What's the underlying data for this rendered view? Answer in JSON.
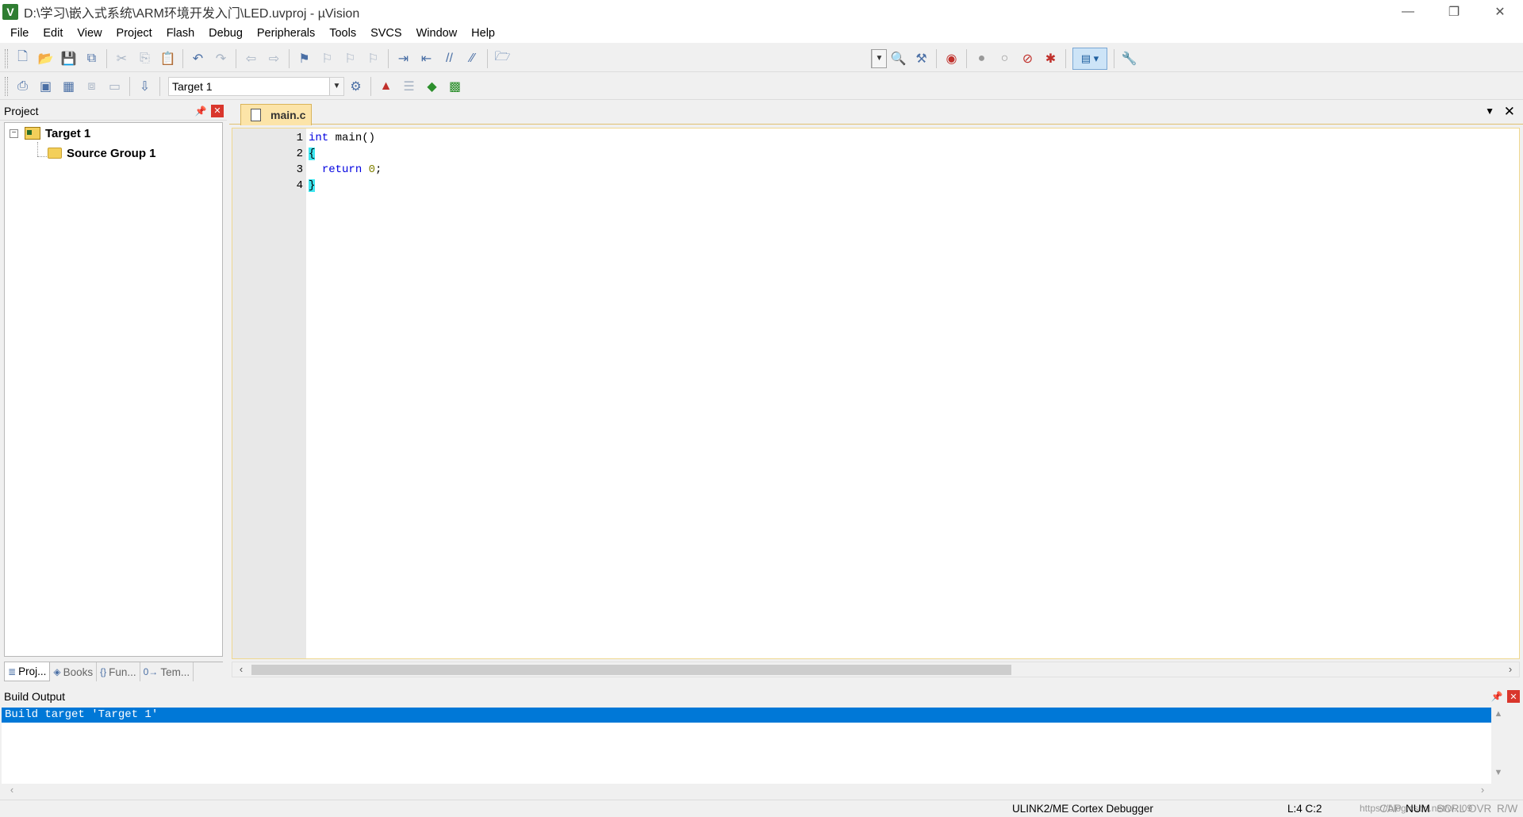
{
  "window": {
    "title": "D:\\学习\\嵌入式系统\\ARM环境开发入门\\LED.uvproj - µVision",
    "app_icon_letter": "V",
    "minimize": "—",
    "restore": "❐",
    "close": "✕"
  },
  "menu": [
    "File",
    "Edit",
    "View",
    "Project",
    "Flash",
    "Debug",
    "Peripherals",
    "Tools",
    "SVCS",
    "Window",
    "Help"
  ],
  "toolbar2": {
    "target_select": "Target 1"
  },
  "project_panel": {
    "title": "Project",
    "tree": {
      "root_label": "Target 1",
      "expander": "−",
      "child_label": "Source Group 1"
    },
    "tabs": [
      "Proj...",
      "Books",
      "Fun...",
      "Tem..."
    ],
    "tab_icons": [
      "≣",
      "◈",
      "{}",
      "0→"
    ]
  },
  "editor": {
    "tab_label": "main.c",
    "lines": [
      {
        "no": "1",
        "tokens": [
          {
            "t": "int",
            "c": "kw"
          },
          {
            "t": " main()",
            "c": ""
          }
        ]
      },
      {
        "no": "2",
        "tokens": [
          {
            "t": "{",
            "c": "brace"
          }
        ]
      },
      {
        "no": "3",
        "tokens": [
          {
            "t": "  ",
            "c": ""
          },
          {
            "t": "return",
            "c": "kw"
          },
          {
            "t": " ",
            "c": ""
          },
          {
            "t": "0",
            "c": "num"
          },
          {
            "t": ";",
            "c": ""
          }
        ]
      },
      {
        "no": "4",
        "tokens": [
          {
            "t": "}",
            "c": "brace"
          }
        ]
      }
    ]
  },
  "build_output": {
    "title": "Build Output",
    "line": "Build target 'Target 1'"
  },
  "statusbar": {
    "debugger": "ULINK2/ME Cortex Debugger",
    "position": "L:4 C:2",
    "cap": "CAP",
    "num": "NUM",
    "scrl": "SCRL",
    "ovr": "OVR",
    "rw": "R/W",
    "watermark": "https://blog.csdn.net/w...09"
  },
  "colors": {
    "accent": "#0078d7",
    "tab_active": "#fce4a8",
    "brace_highlight": "#3ee6f0",
    "close_red": "#d9362c"
  }
}
